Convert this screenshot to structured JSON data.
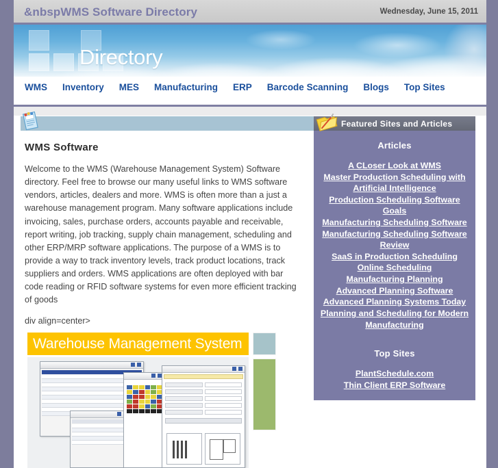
{
  "header": {
    "site_title": "&nbspWMS Software Directory",
    "date": "Wednesday, June 15, 2011"
  },
  "hero": {
    "word": "Directory",
    "document_icon": "document-icon"
  },
  "nav": {
    "items": [
      {
        "label": "WMS"
      },
      {
        "label": "Inventory"
      },
      {
        "label": "MES"
      },
      {
        "label": "Manufacturing"
      },
      {
        "label": "ERP"
      },
      {
        "label": "Barcode Scanning"
      },
      {
        "label": "Blogs"
      },
      {
        "label": "Top Sites"
      }
    ]
  },
  "main": {
    "heading": "WMS Software",
    "paragraph": "Welcome to the WMS (Warehouse Management System) Software directory. Feel free to browse our many useful links to WMS software vendors, articles, dealers and more. WMS is often more than a just a warehouse management program. Many software applications include invoicing, sales, purchase orders, accounts payable and receivable, report writing, job tracking, supply chain management, scheduling and other ERP/MRP software applications. The purpose of a WMS is to provide a way to track inventory levels, track product locations, track suppliers and orders. WMS applications are often deployed with bar code reading or RFID software systems for even more efficient tracking of goods",
    "raw_tag": "div align=center>",
    "screenshot_banner": "Warehouse Management System"
  },
  "sidebar": {
    "panel_title": "Featured Sites and Articles",
    "folder_icon": "folder-icon",
    "articles_title": "Articles",
    "articles": [
      {
        "label": "A CLoser Look at WMS"
      },
      {
        "label": "Master Production Scheduling with"
      },
      {
        "label": "Artificial Intelligence"
      },
      {
        "label": "Production Scheduling Software Goals"
      },
      {
        "label": "Manufacturing Scheduling Software"
      },
      {
        "label": "Manufacturing Scheduling Software"
      },
      {
        "label": "Review"
      },
      {
        "label": "SaaS in Production Scheduling"
      },
      {
        "label": "Online Scheduling"
      },
      {
        "label": "Manufacturing Planning"
      },
      {
        "label": "Advanced Planning Software"
      },
      {
        "label": "Advanced Planning Systems Today"
      },
      {
        "label": "Planning and Scheduling for Modern"
      },
      {
        "label": "Manufacturing"
      }
    ],
    "top_sites_title": "Top Sites",
    "top_sites": [
      {
        "label": "PlantSchedule.com"
      },
      {
        "label": "Thin Client ERP Software"
      }
    ]
  },
  "colors": {
    "body_background": "#7d7d9c",
    "title_text": "#7b7ba8",
    "nav_link": "#1a4f9c",
    "sidebar_background": "#7b7ba5",
    "sidebar_header": "#6b6f7e",
    "accent_strip": "#a7c3d3",
    "screenshot_banner": "#fdc300"
  }
}
